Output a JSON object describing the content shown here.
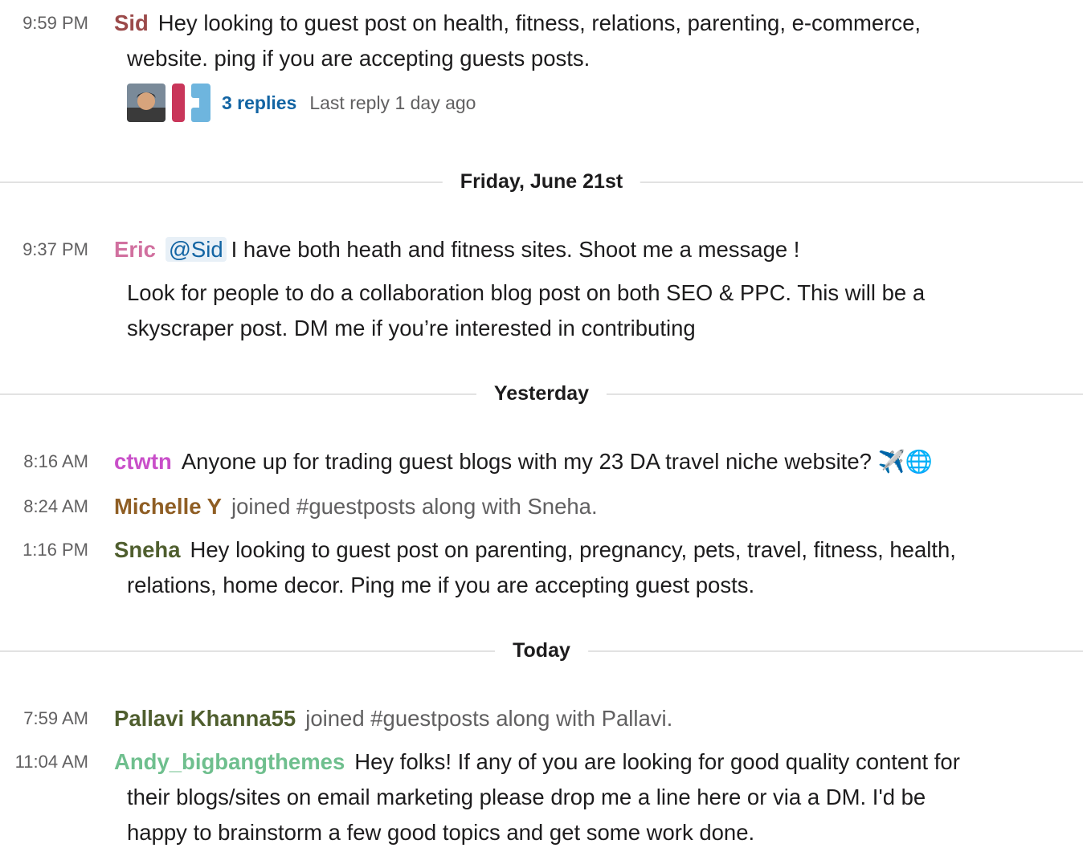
{
  "messages": {
    "m0": {
      "time": "9:59 PM",
      "author": "Sid",
      "author_color": "#9b4a4a",
      "line1": "Hey looking to guest post on health, fitness, relations, parenting, e-commerce,",
      "line2": "website. ping if you are accepting guests posts.",
      "thread": {
        "replies": "3 replies",
        "last_reply": "Last reply 1 day ago"
      }
    },
    "m1": {
      "time": "9:37 PM",
      "author": "Eric",
      "author_color": "#d1709f",
      "mention": "@Sid",
      "line1": "I have both heath and fitness sites. Shoot me a message !",
      "line2": "Look for people to do a collaboration blog post on both SEO & PPC. This will be a",
      "line3": "skyscraper post. DM me if you’re interested in contributing"
    },
    "m2": {
      "time": "8:16 AM",
      "author": "ctwtn",
      "author_color": "#c94fc9",
      "line1": "Anyone up for trading guest blogs with my 23 DA travel niche website?",
      "emoji": "✈️🌐"
    },
    "m3": {
      "time": "8:24 AM",
      "author": "Michelle Y",
      "author_color": "#8f5e24",
      "line1": "joined #guestposts along with Sneha."
    },
    "m4": {
      "time": "1:16 PM",
      "author": "Sneha",
      "author_color": "#4f5e2e",
      "line1": "Hey looking to guest post on parenting, pregnancy, pets, travel, fitness, health,",
      "line2": "relations, home decor. Ping me if you are accepting guest posts."
    },
    "m5": {
      "time": "7:59 AM",
      "author": "Pallavi Khanna55",
      "author_color": "#4f5e2e",
      "line1": "joined #guestposts along with Pallavi."
    },
    "m6": {
      "time": "11:04 AM",
      "author": "Andy_bigbangthemes",
      "author_color": "#6fbf8e",
      "line1": "Hey folks! If any of you are looking for good quality content for",
      "line2": "their blogs/sites on email marketing please drop me a line here or via a DM. I'd be",
      "line3": "happy to brainstorm a few good topics and get some work done."
    }
  },
  "dividers": {
    "d1": "Friday, June 21st",
    "d2": "Yesterday",
    "d3": "Today"
  }
}
